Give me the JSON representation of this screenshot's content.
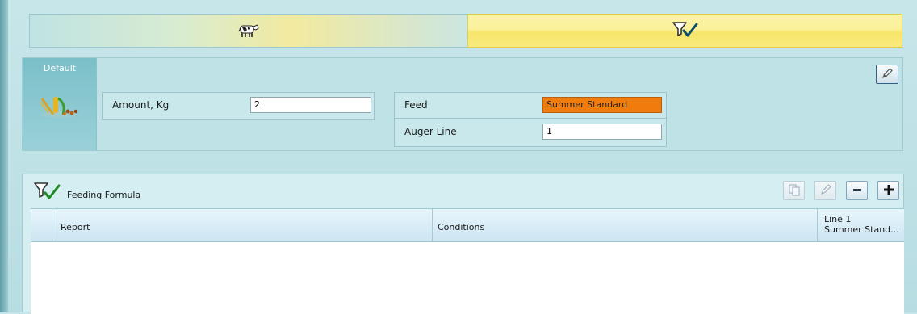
{
  "tabs": [
    {
      "name": "animals",
      "icon": "cow-icon"
    },
    {
      "name": "feeding",
      "icon": "funnel-check-icon",
      "selected": true
    }
  ],
  "settings": {
    "default_label": "Default",
    "amount_label": "Amount, Kg",
    "amount_value": "2",
    "feed_label": "Feed",
    "feed_value": "Summer Standard",
    "auger_label": "Auger Line",
    "auger_value": "1"
  },
  "formula": {
    "title": "Feeding Formula",
    "columns": {
      "report": "Report",
      "conditions": "Conditions",
      "line1_top": "Line 1",
      "line1_bottom": "Summer Stand..."
    },
    "rows": []
  },
  "colors": {
    "accent": "#7bbfc9",
    "feed_highlight": "#f07c0e",
    "selected_tab": "#f9ea7c"
  }
}
